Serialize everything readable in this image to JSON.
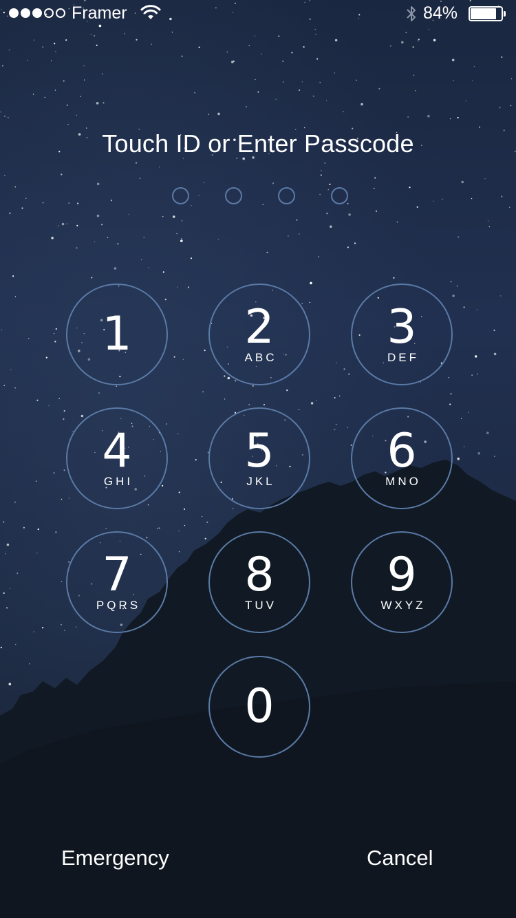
{
  "status_bar": {
    "signal_bars": [
      true,
      true,
      true,
      false,
      false
    ],
    "carrier": "Framer",
    "wifi_icon": "wifi-icon",
    "bluetooth_icon": "bluetooth-icon",
    "battery_percent_label": "84%",
    "battery_level": 0.84
  },
  "prompt": {
    "title": "Touch ID or Enter Passcode",
    "passcode_length": 4,
    "entered": 0
  },
  "keypad": {
    "keys": [
      {
        "digit": "1",
        "letters": ""
      },
      {
        "digit": "2",
        "letters": "ABC"
      },
      {
        "digit": "3",
        "letters": "DEF"
      },
      {
        "digit": "4",
        "letters": "GHI"
      },
      {
        "digit": "5",
        "letters": "JKL"
      },
      {
        "digit": "6",
        "letters": "MNO"
      },
      {
        "digit": "7",
        "letters": "PQRS"
      },
      {
        "digit": "8",
        "letters": "TUV"
      },
      {
        "digit": "9",
        "letters": "WXYZ"
      },
      {
        "digit": "0",
        "letters": ""
      }
    ]
  },
  "actions": {
    "emergency_label": "Emergency",
    "cancel_label": "Cancel"
  },
  "colors": {
    "ring": "#5a7aa6",
    "sky_top": "#1d2b44",
    "sky_bottom": "#121a26",
    "trees": "#111a24"
  }
}
